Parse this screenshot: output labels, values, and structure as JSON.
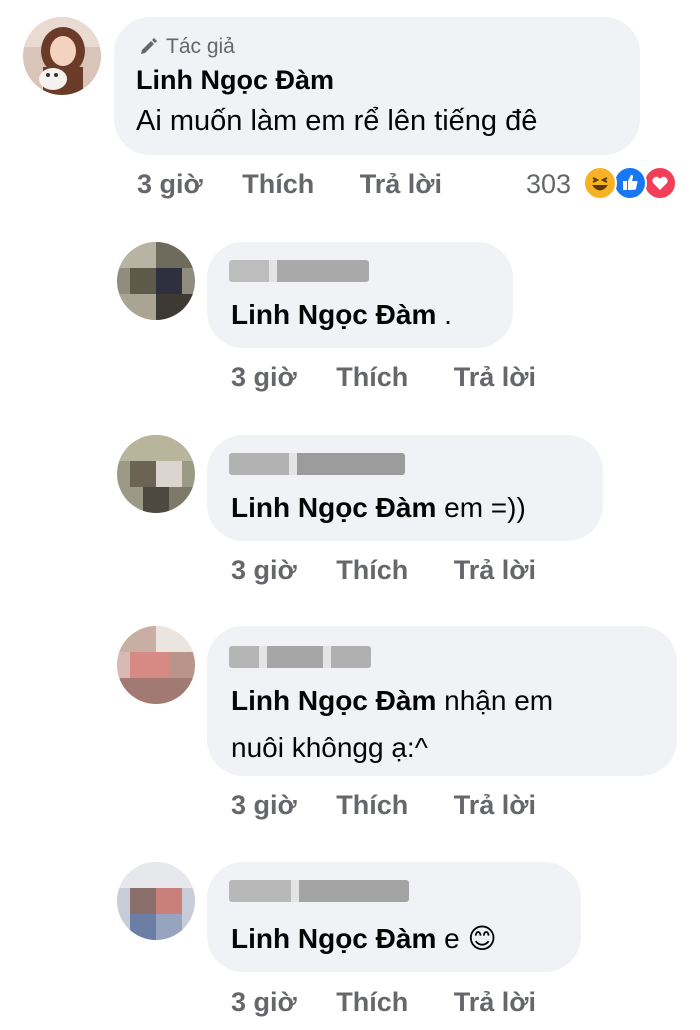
{
  "main_comment": {
    "badge": "Tác giả",
    "author": "Linh Ngọc Đàm",
    "text": "Ai muốn làm em rể lên tiếng đê",
    "time": "3 giờ",
    "like": "Thích",
    "reply": "Trả lời",
    "reaction_count": "303",
    "reactions": [
      "haha-icon",
      "like-icon",
      "love-icon"
    ]
  },
  "replies": [
    {
      "mention": "Linh Ngọc Đàm",
      "text": " .",
      "time": "3 giờ",
      "like": "Thích",
      "reply": "Trả lời"
    },
    {
      "mention": "Linh Ngọc Đàm",
      "text": " em =))",
      "time": "3 giờ",
      "like": "Thích",
      "reply": "Trả lời"
    },
    {
      "mention": "Linh Ngọc Đàm",
      "text": " nhận em",
      "text2": "nuôi khôngg ạ:^",
      "time": "3 giờ",
      "like": "Thích",
      "reply": "Trả lời"
    },
    {
      "mention": "Linh Ngọc Đàm",
      "text": " e",
      "emoji": "😊",
      "time": "3 giờ",
      "like": "Thích",
      "reply": "Trả lời"
    }
  ],
  "colors": {
    "bubble": "#f0f2f5",
    "meta": "#65676b",
    "like_blue": "#1877f2",
    "love_red": "#f33e58",
    "haha_yellow": "#f7b125"
  }
}
